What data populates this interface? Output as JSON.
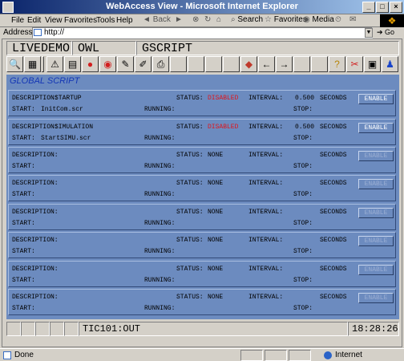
{
  "window": {
    "title": "WebAccess View - Microsoft Internet Explorer",
    "controls": {
      "minimize": "_",
      "maximize": "□",
      "close": "×"
    }
  },
  "menu": {
    "items": [
      "File",
      "Edit",
      "View",
      "Favorites",
      "Tools",
      "Help"
    ],
    "toolbar": {
      "back": "Back",
      "search": "Search",
      "favorites": "Favorites",
      "media": "Media"
    }
  },
  "address": {
    "label": "Address",
    "value": "http://",
    "go": "Go"
  },
  "hmi": {
    "node": "LIVEDEMO",
    "project": "OWL",
    "page": "GSCRIPT",
    "section_title": "GLOBAL SCRIPT",
    "labels": {
      "description": "DESCRIPTION:",
      "status": "STATUS:",
      "interval": "INTERVAL:",
      "seconds": "SECONDS",
      "start": "START:",
      "running": "RUNNING:",
      "stop": "STOP:",
      "enable": "ENABLE"
    },
    "scripts": [
      {
        "description": "STARTUP",
        "status": "DISABLED",
        "interval": "0.500",
        "start": "InitCom.scr",
        "active": true
      },
      {
        "description": "SIMULATION",
        "status": "DISABLED",
        "interval": "0.500",
        "start": "StartSIMU.scr",
        "active": true
      },
      {
        "description": "",
        "status": "NONE",
        "interval": "",
        "start": "",
        "active": false
      },
      {
        "description": "",
        "status": "NONE",
        "interval": "",
        "start": "",
        "active": false
      },
      {
        "description": "",
        "status": "NONE",
        "interval": "",
        "start": "",
        "active": false
      },
      {
        "description": "",
        "status": "NONE",
        "interval": "",
        "start": "",
        "active": false
      },
      {
        "description": "",
        "status": "NONE",
        "interval": "",
        "start": "",
        "active": false
      },
      {
        "description": "",
        "status": "NONE",
        "interval": "",
        "start": "",
        "active": false
      }
    ],
    "footer": {
      "tag": "TIC101:OUT",
      "clock": "18:28:26"
    }
  },
  "status": {
    "text": "Done",
    "zone": "Internet"
  },
  "colors": {
    "panel": "#6c8bbf",
    "title": "#1537b5",
    "disabled": "#e0141a"
  }
}
